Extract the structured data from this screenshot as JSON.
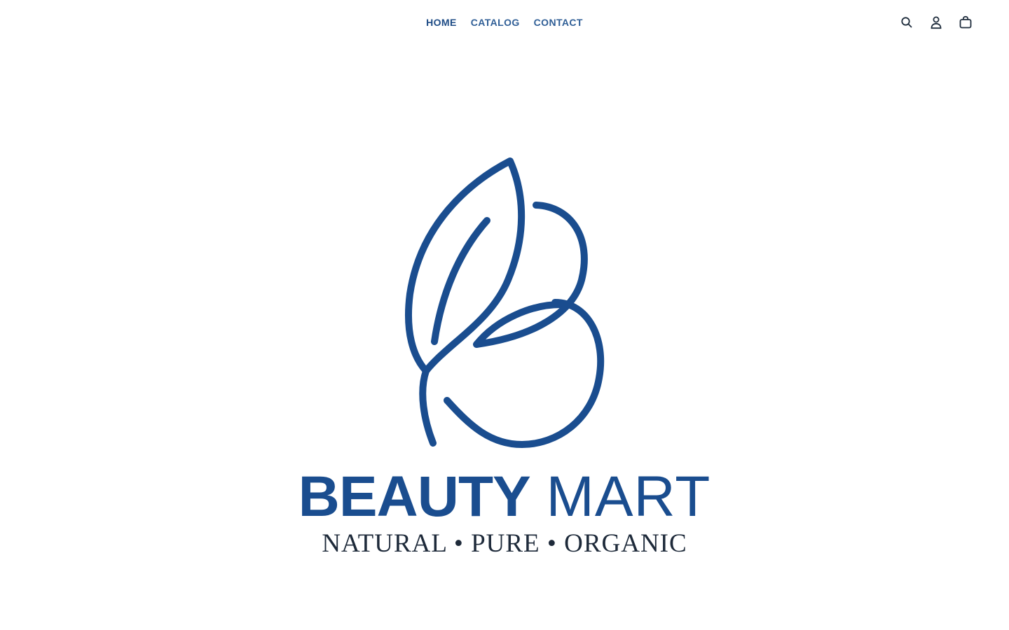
{
  "header": {
    "nav": [
      {
        "label": "HOME",
        "active": true
      },
      {
        "label": "CATALOG",
        "active": false
      },
      {
        "label": "CONTACT",
        "active": false
      }
    ],
    "icons": [
      "search-icon",
      "account-icon",
      "cart-icon"
    ]
  },
  "hero": {
    "logo": {
      "brand_bold": "BEAUTY",
      "brand_light": "MART",
      "tagline": "NATURAL • PURE • ORGANIC"
    }
  },
  "colors": {
    "brand_blue": "#1a4d8f",
    "nav_text": "#2f5e96",
    "tagline": "#1e2a3a",
    "background": "#ffffff"
  }
}
